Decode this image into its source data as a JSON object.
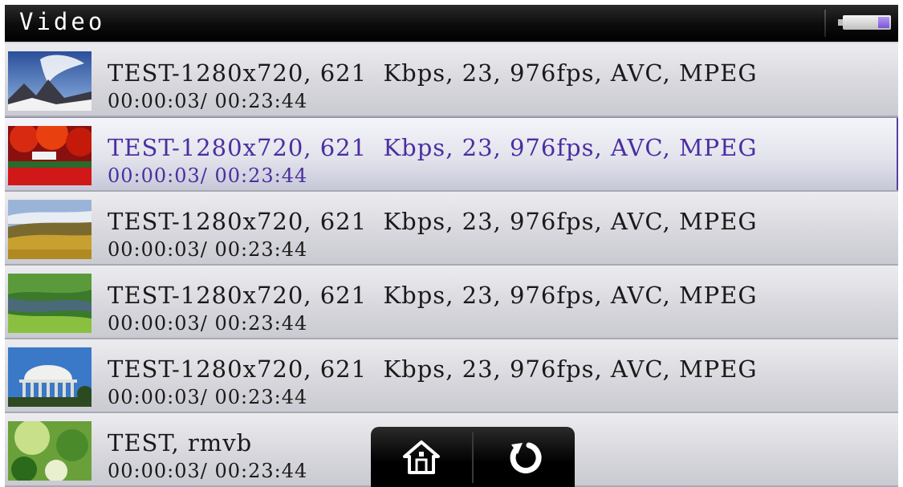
{
  "header": {
    "title": "Video",
    "battery_icon": "battery-icon",
    "battery_color": "#7a55d8"
  },
  "list": {
    "selected_index": 1,
    "selected_color": "#4b2fa0",
    "items": [
      {
        "title": "TEST-1280x720, 621  Kbps, 23, 976fps, AVC, MPEG",
        "time": "00:00:03/ 00:23:44",
        "thumbnail": "mountain-clouds-thumbnail"
      },
      {
        "title": "TEST-1280x720, 621  Kbps, 23, 976fps, AVC, MPEG",
        "time": "00:00:03/ 00:23:44",
        "thumbnail": "red-autumn-trees-thumbnail"
      },
      {
        "title": "TEST-1280x720, 621  Kbps, 23, 976fps, AVC, MPEG",
        "time": "00:00:03/ 00:23:44",
        "thumbnail": "golden-hills-thumbnail"
      },
      {
        "title": "TEST-1280x720, 621  Kbps, 23, 976fps, AVC, MPEG",
        "time": "00:00:03/ 00:23:44",
        "thumbnail": "green-valley-thumbnail"
      },
      {
        "title": "TEST-1280x720, 621  Kbps, 23, 976fps, AVC, MPEG",
        "time": "00:00:03/ 00:23:44",
        "thumbnail": "memorial-dome-thumbnail"
      },
      {
        "title": "TEST, rmvb",
        "time": "00:00:03/ 00:23:44",
        "thumbnail": "green-plants-thumbnail"
      }
    ]
  },
  "nav": {
    "home_icon": "home-icon",
    "back_icon": "back-icon",
    "back_color": "#7a55d8"
  }
}
